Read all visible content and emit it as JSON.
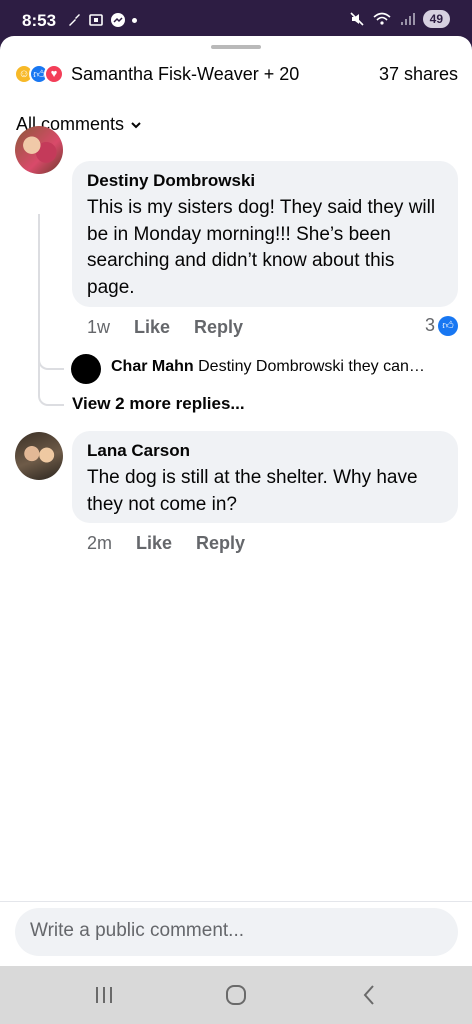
{
  "status_bar": {
    "time": "8:53",
    "battery": "49"
  },
  "reactions": {
    "names": "Samantha Fisk-Weaver + 20",
    "shares": "37 shares",
    "icons": [
      "care-icon",
      "like-icon",
      "love-icon"
    ]
  },
  "filter": {
    "label": "All comments"
  },
  "comments": [
    {
      "author": "Destiny Dombrowski",
      "text": "This is my sisters dog! They said they will be in Monday morning!!! She’s been searching and didn’t know about this page.",
      "time": "1w",
      "like": "Like",
      "reply": "Reply",
      "reaction_count": "3",
      "reply_preview": {
        "author": "Char Mahn",
        "text": "Destiny Dombrowski they can…"
      },
      "view_more": "View 2 more replies..."
    },
    {
      "author": "Lana Carson",
      "text": "The dog is still at the shelter. Why have they not come in?",
      "time": "2m",
      "like": "Like",
      "reply": "Reply"
    }
  ],
  "composer": {
    "placeholder": "Write a public comment..."
  },
  "colors": {
    "accent": "#1877f2",
    "status_bar_bg": "#2d1d43",
    "bubble_bg": "#f0f2f5"
  }
}
